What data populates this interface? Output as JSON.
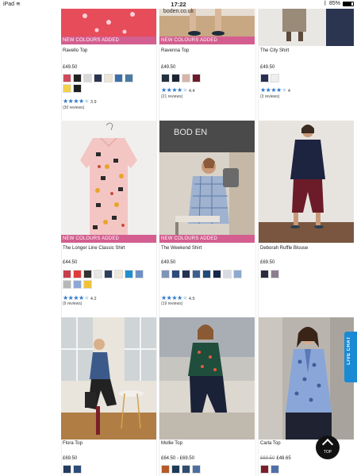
{
  "status_bar": {
    "device": "iPad",
    "time": "17:22",
    "battery": "85%"
  },
  "url": "boden.co.uk",
  "badge_text": "NEW COLOURS ADDED",
  "products": [
    {
      "name": "Ravello Top",
      "price": "£49.50",
      "badge": true,
      "rating_value": "3.9",
      "stars": 4,
      "reviews": "(30 reviews)",
      "swatches": [
        "#cf4a5c",
        "#222222",
        "#d8d8d8",
        "#2b3550",
        "#ece6d6",
        "#3e6fa8",
        "#4a7aa2",
        "#f2d24a",
        "#1e1e1e"
      ]
    },
    {
      "name": "Ravenna Top",
      "price": "£49.50",
      "badge": true,
      "rating_value": "4.4",
      "stars": 4,
      "reviews": "(21 reviews)",
      "swatches": [
        "#243040",
        "#1f2433",
        "#d7b4a8",
        "#6b1a2a"
      ]
    },
    {
      "name": "The City Shirt",
      "price": "£49.50",
      "badge": false,
      "rating_value": "4",
      "stars": 4,
      "reviews": "(3 reviews)",
      "swatches": [
        "#2a2f52",
        "#eeeeee"
      ]
    },
    {
      "name": "The Longer Line Classic Shirt",
      "price": "£44.50",
      "badge": true,
      "rating_value": "4.2",
      "stars": 4,
      "reviews": "(9 reviews)",
      "swatches": [
        "#c63f4c",
        "#e03a3a",
        "#333333",
        "#e6e6e6",
        "#2c3d5e",
        "#ece8d8",
        "#1f8fd0",
        "#6e8fc4",
        "#b7b7b7",
        "#8da7d6",
        "#f0c23a"
      ]
    },
    {
      "name": "The Weekend Shirt",
      "price": "£49.50",
      "badge": true,
      "rating_value": "4.5",
      "stars": 4,
      "reviews": "(19 reviews)",
      "swatches": [
        "#7e93b8",
        "#2e4a7a",
        "#233350",
        "#3d5f8f",
        "#1f4a7a",
        "#18284a",
        "#d8dbe2",
        "#8ea9cf"
      ]
    },
    {
      "name": "Deborah Ruffle Blouse",
      "price": "£69.50",
      "badge": false,
      "swatches": [
        "#2a2a40",
        "#8c7e90"
      ]
    },
    {
      "name": "Flora Top",
      "price": "£69.50",
      "badge": false,
      "swatches": [
        "#243a5e",
        "#2c4d7a"
      ]
    },
    {
      "name": "Mollie Top",
      "price": "£64.50 - £69.50",
      "badge": false,
      "swatches": [
        "#b65a2a",
        "#1f3a58",
        "#2f4d6e",
        "#4a6fa0"
      ]
    },
    {
      "name": "Carla Top",
      "price_was": "£69.50",
      "price": "£48.65",
      "badge": false,
      "swatches": [
        "#7a1f2a",
        "#4f6fa8"
      ]
    }
  ],
  "live_chat": "LIVE CHAT",
  "top_button": "TOP"
}
